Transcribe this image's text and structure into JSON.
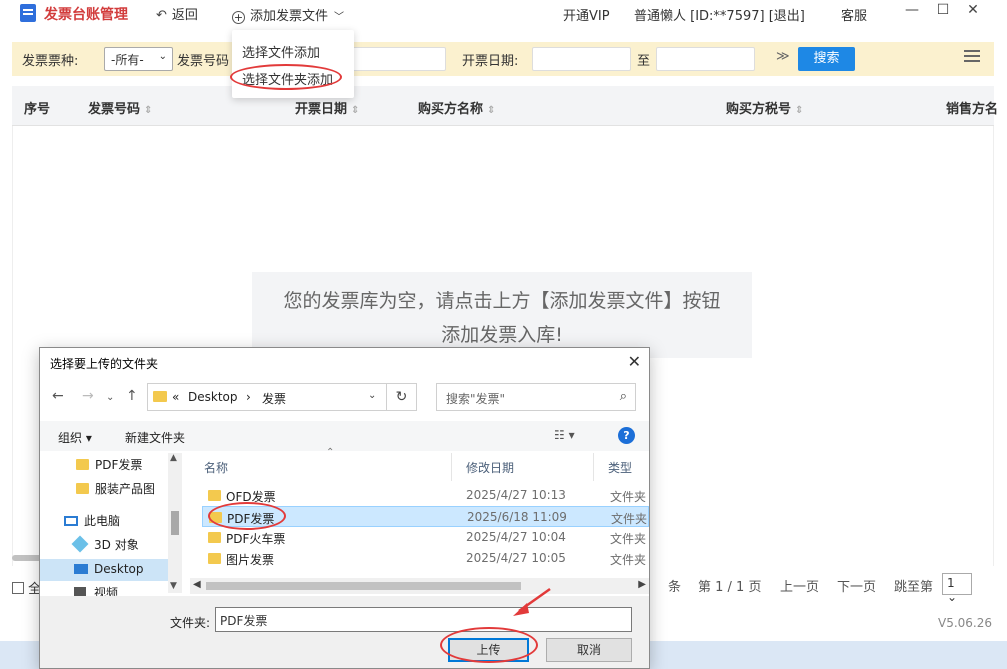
{
  "app": {
    "title": "发票台账管理",
    "back": "返回",
    "add_files": "添加发票文件",
    "vip": "开通VIP",
    "user": "普通懒人 [ID:**7597] [退出]",
    "service": "客服",
    "minimize": "—",
    "maximize": "☐",
    "close": "✕",
    "version": "V5.06.26"
  },
  "add_menu": {
    "items": [
      "选择文件添加",
      "选择文件夹添加"
    ]
  },
  "filter": {
    "type_label": "发票票种:",
    "type_value": "-所有-",
    "number_label": "发票号码",
    "date_label": "开票日期:",
    "to": "至",
    "expand": "≫",
    "search": "搜索"
  },
  "table": {
    "columns": [
      "序号",
      "发票号码",
      "开票日期",
      "购买方名称",
      "购买方税号",
      "销售方名"
    ],
    "empty_line1": "您的发票库为空，请点击上方【添加发票文件】按钮",
    "empty_line2": "添加发票入库!"
  },
  "footer": {
    "select_all": "全",
    "unit": "条",
    "page_info": "第 1 / 1 页",
    "prev": "上一页",
    "next": "下一页",
    "jump": "跳至第",
    "page_value": "1"
  },
  "dialog": {
    "title": "选择要上传的文件夹",
    "breadcrumb": [
      "«",
      "Desktop",
      "›",
      "发票"
    ],
    "search_placeholder": "搜索\"发票\"",
    "organize": "组织 ▾",
    "new_folder": "新建文件夹",
    "nav": [
      "PDF发票",
      "服装产品图",
      "此电脑",
      "3D 对象",
      "Desktop",
      "视频"
    ],
    "columns": [
      "名称",
      "修改日期",
      "类型"
    ],
    "files": [
      {
        "name": "OFD发票",
        "date": "2025/4/27 10:13",
        "type": "文件夹"
      },
      {
        "name": "PDF发票",
        "date": "2025/6/18 11:09",
        "type": "文件夹"
      },
      {
        "name": "PDF火车票",
        "date": "2025/4/27 10:04",
        "type": "文件夹"
      },
      {
        "name": "图片发票",
        "date": "2025/4/27 10:05",
        "type": "文件夹"
      }
    ],
    "folder_label": "文件夹:",
    "folder_value": "PDF发票",
    "upload": "上传",
    "cancel": "取消"
  },
  "colors": {
    "accent_blue": "#1e88e5",
    "brand_red": "#d23c3c",
    "filter_bg": "#fbf1cf",
    "annotation_red": "#e23a3a"
  }
}
